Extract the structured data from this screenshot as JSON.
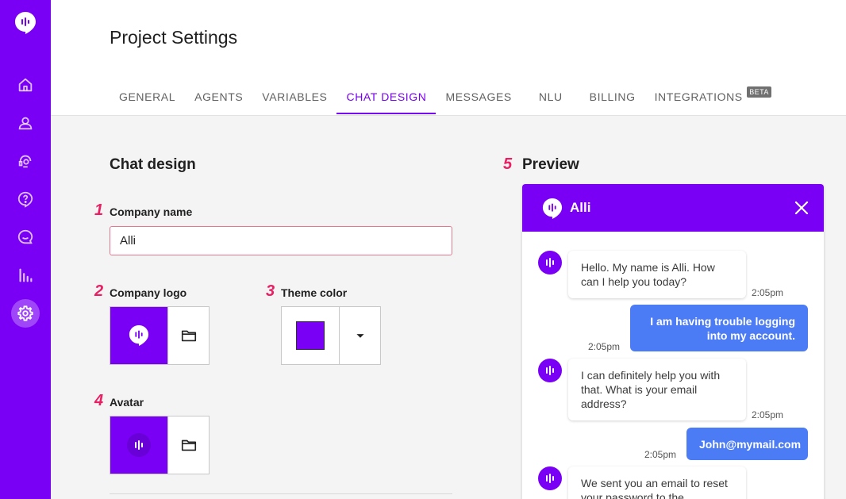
{
  "sidebar": {
    "items": [
      {
        "icon": "home-icon"
      },
      {
        "icon": "user-icon"
      },
      {
        "icon": "agent-icon"
      },
      {
        "icon": "help-icon"
      },
      {
        "icon": "chat-icon"
      },
      {
        "icon": "analytics-icon"
      },
      {
        "icon": "settings-icon",
        "active": true
      }
    ]
  },
  "header": {
    "title": "Project Settings",
    "tabs": [
      {
        "label": "GENERAL"
      },
      {
        "label": "AGENTS"
      },
      {
        "label": "VARIABLES"
      },
      {
        "label": "CHAT DESIGN",
        "active": true
      },
      {
        "label": "MESSAGES"
      },
      {
        "label": "NLU"
      },
      {
        "label": "BILLING"
      },
      {
        "label": "INTEGRATIONS",
        "badge": "BETA"
      }
    ]
  },
  "form": {
    "title": "Chat design",
    "company_name": {
      "step": "1",
      "label": "Company name",
      "value": "Alli"
    },
    "company_logo": {
      "step": "2",
      "label": "Company logo"
    },
    "theme_color": {
      "step": "3",
      "label": "Theme color",
      "value": "#7a00f5"
    },
    "avatar": {
      "step": "4",
      "label": "Avatar"
    }
  },
  "preview": {
    "step": "5",
    "title": "Preview",
    "chat_title": "Alli",
    "messages": [
      {
        "from": "bot",
        "text": "Hello. My name is Alli. How can I help you today?",
        "time": "2:05pm"
      },
      {
        "from": "user",
        "text": "I am having trouble logging into my account.",
        "time": "2:05pm"
      },
      {
        "from": "bot",
        "text": "I can definitely help you with that. What is your email address?",
        "time": "2:05pm"
      },
      {
        "from": "user",
        "text": "John@mymail.com",
        "time": "2:05pm"
      },
      {
        "from": "bot",
        "text": "We sent you an email to reset your password to the",
        "time": ""
      }
    ]
  },
  "colors": {
    "brand": "#7a00f5",
    "user_bubble": "#4b7bf5",
    "accent": "#e91e63"
  }
}
